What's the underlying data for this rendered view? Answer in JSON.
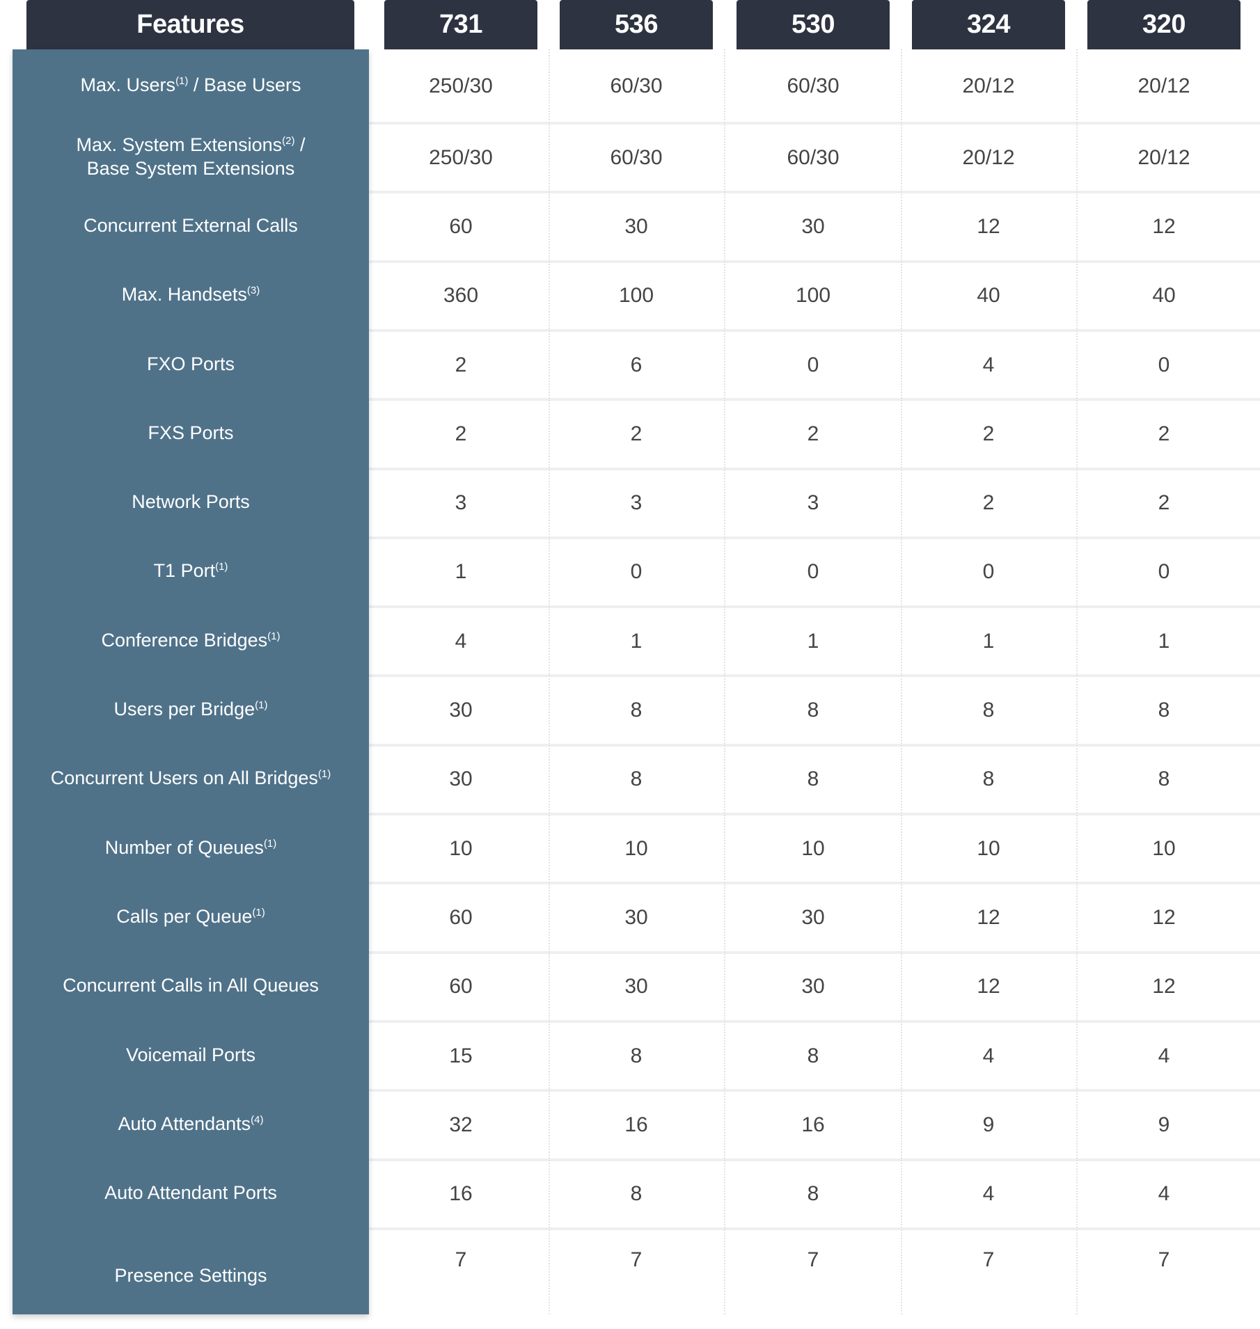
{
  "header": {
    "features_label": "Features",
    "models": [
      "731",
      "536",
      "530",
      "324",
      "320"
    ]
  },
  "colors": {
    "header_bg": "#2d3340",
    "feature_panel_bg": "#4f7289",
    "value_text": "#444444",
    "row_separator": "#efeff2"
  },
  "rows": [
    {
      "feature": "Max. Users",
      "footnote": "(1)",
      "suffix": " / Base Users",
      "values": [
        "250/30",
        "60/30",
        "60/30",
        "20/12",
        "20/12"
      ]
    },
    {
      "feature": "Max. System Extensions",
      "footnote": "(2)",
      "suffix": " / Base System Extensions",
      "values": [
        "250/30",
        "60/30",
        "60/30",
        "20/12",
        "20/12"
      ]
    },
    {
      "feature": "Concurrent External Calls",
      "footnote": "",
      "suffix": "",
      "values": [
        "60",
        "30",
        "30",
        "12",
        "12"
      ]
    },
    {
      "feature": "Max. Handsets",
      "footnote": "(3)",
      "suffix": "",
      "values": [
        "360",
        "100",
        "100",
        "40",
        "40"
      ]
    },
    {
      "feature": "FXO Ports",
      "footnote": "",
      "suffix": "",
      "values": [
        "2",
        "6",
        "0",
        "4",
        "0"
      ]
    },
    {
      "feature": "FXS Ports",
      "footnote": "",
      "suffix": "",
      "values": [
        "2",
        "2",
        "2",
        "2",
        "2"
      ]
    },
    {
      "feature": "Network Ports",
      "footnote": "",
      "suffix": "",
      "values": [
        "3",
        "3",
        "3",
        "2",
        "2"
      ]
    },
    {
      "feature": "T1 Port",
      "footnote": "(1)",
      "suffix": "",
      "values": [
        "1",
        "0",
        "0",
        "0",
        "0"
      ]
    },
    {
      "feature": "Conference Bridges",
      "footnote": "(1)",
      "suffix": "",
      "values": [
        "4",
        "1",
        "1",
        "1",
        "1"
      ]
    },
    {
      "feature": "Users per Bridge",
      "footnote": "(1)",
      "suffix": "",
      "values": [
        "30",
        "8",
        "8",
        "8",
        "8"
      ]
    },
    {
      "feature": "Concurrent Users on All Bridges",
      "footnote": "(1)",
      "suffix": "",
      "values": [
        "30",
        "8",
        "8",
        "8",
        "8"
      ]
    },
    {
      "feature": "Number of Queues",
      "footnote": "(1)",
      "suffix": "",
      "values": [
        "10",
        "10",
        "10",
        "10",
        "10"
      ]
    },
    {
      "feature": "Calls per Queue",
      "footnote": "(1)",
      "suffix": "",
      "values": [
        "60",
        "30",
        "30",
        "12",
        "12"
      ]
    },
    {
      "feature": "Concurrent Calls in All Queues",
      "footnote": "",
      "suffix": "",
      "values": [
        "60",
        "30",
        "30",
        "12",
        "12"
      ]
    },
    {
      "feature": "Voicemail Ports",
      "footnote": "",
      "suffix": "",
      "values": [
        "15",
        "8",
        "8",
        "4",
        "4"
      ]
    },
    {
      "feature": "Auto Attendants",
      "footnote": "(4)",
      "suffix": "",
      "values": [
        "32",
        "16",
        "16",
        "9",
        "9"
      ]
    },
    {
      "feature": "Auto Attendant Ports",
      "footnote": "",
      "suffix": "",
      "values": [
        "16",
        "8",
        "8",
        "4",
        "4"
      ]
    },
    {
      "feature": "Presence Settings",
      "footnote": "",
      "suffix": "",
      "values": [
        "7",
        "7",
        "7",
        "7",
        "7"
      ]
    }
  ]
}
